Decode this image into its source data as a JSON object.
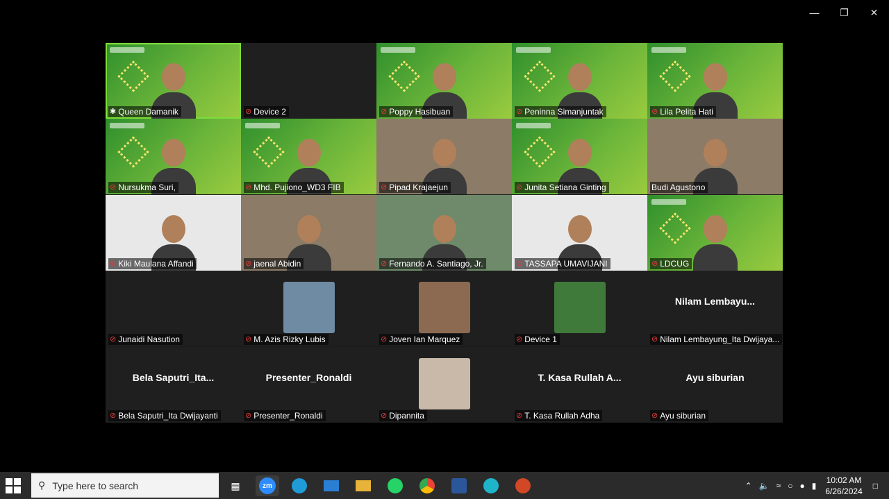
{
  "window": {
    "minimize_glyph": "—",
    "restore_glyph": "❐",
    "close_glyph": "✕"
  },
  "participants": [
    {
      "name": "Queen Damanik",
      "mic": "pin",
      "bg": "green"
    },
    {
      "name": "Device 2",
      "mic": "muted",
      "bg": "dark"
    },
    {
      "name": "Poppy Hasibuan",
      "mic": "muted",
      "bg": "green"
    },
    {
      "name": "Peninna Simanjuntak",
      "mic": "muted",
      "bg": "green"
    },
    {
      "name": "Lila Pelita Hati",
      "mic": "muted",
      "bg": "green"
    },
    {
      "name": "Nursukma Suri,",
      "mic": "muted",
      "bg": "green"
    },
    {
      "name": "Mhd. Pujiono_WD3 FIB",
      "mic": "muted",
      "bg": "green"
    },
    {
      "name": "Pipad Krajaejun",
      "mic": "muted",
      "bg": "room"
    },
    {
      "name": "Junita Setiana Ginting",
      "mic": "muted",
      "bg": "green"
    },
    {
      "name": "Budi Agustono",
      "mic": "none",
      "bg": "room"
    },
    {
      "name": "Kiki Maulana Affandi",
      "mic": "muted",
      "bg": "light"
    },
    {
      "name": "jaenal Abidin",
      "mic": "muted",
      "bg": "room"
    },
    {
      "name": "Fernando A. Santiago, Jr.",
      "mic": "muted",
      "bg": "outdoor"
    },
    {
      "name": "TASSAPA UMAVIJANI",
      "mic": "muted",
      "bg": "light"
    },
    {
      "name": "LDCUG",
      "mic": "muted",
      "bg": "green"
    },
    {
      "name": "Junaidi Nasution",
      "mic": "muted",
      "bg": "dark"
    },
    {
      "name": "M. Azis Rizky Lubis",
      "mic": "muted",
      "bg": "dark",
      "thumb": "#6f8aa3"
    },
    {
      "name": "Joven Ian Marquez",
      "mic": "muted",
      "bg": "dark",
      "thumb": "#8c6a52"
    },
    {
      "name": "Device 1",
      "mic": "muted",
      "bg": "dark",
      "thumb": "#3f7a3a"
    },
    {
      "name": "Nilam Lembayung_Ita Dwijaya...",
      "mic": "muted",
      "bg": "dark",
      "big": "Nilam  Lembayu..."
    },
    {
      "name": "Bela Saputri_Ita Dwijayanti",
      "mic": "muted",
      "bg": "dark",
      "big": "Bela  Saputri_Ita..."
    },
    {
      "name": "Presenter_Ronaldi",
      "mic": "muted",
      "bg": "dark",
      "big": "Presenter_Ronaldi"
    },
    {
      "name": "Dipannita",
      "mic": "muted",
      "bg": "dark",
      "thumb": "#c9b9a8"
    },
    {
      "name": "T. Kasa Rullah Adha",
      "mic": "muted",
      "bg": "dark",
      "big": "T. Kasa Rullah A..."
    },
    {
      "name": "Ayu siburian",
      "mic": "muted",
      "bg": "dark",
      "big": "Ayu siburian"
    }
  ],
  "taskbar": {
    "search_placeholder": "Type here to search",
    "zoom_label": "zm",
    "time": "10:02 AM",
    "date": "6/26/2024"
  }
}
